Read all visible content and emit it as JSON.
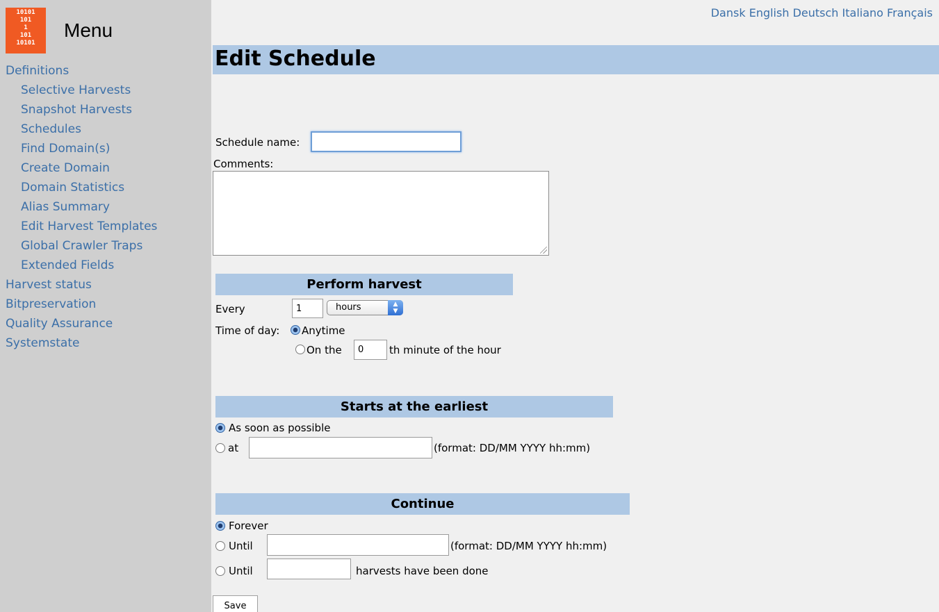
{
  "sidebar": {
    "menu_title": "Menu",
    "logo_bits": [
      "10101",
      "101",
      "1",
      "101",
      "10101"
    ],
    "items": [
      {
        "label": "Definitions",
        "level": "top"
      },
      {
        "label": "Selective Harvests",
        "level": "sub"
      },
      {
        "label": "Snapshot Harvests",
        "level": "sub"
      },
      {
        "label": "Schedules",
        "level": "sub"
      },
      {
        "label": "Find Domain(s)",
        "level": "sub"
      },
      {
        "label": "Create Domain",
        "level": "sub"
      },
      {
        "label": "Domain Statistics",
        "level": "sub"
      },
      {
        "label": "Alias Summary",
        "level": "sub"
      },
      {
        "label": "Edit Harvest Templates",
        "level": "sub"
      },
      {
        "label": "Global Crawler Traps",
        "level": "sub"
      },
      {
        "label": "Extended Fields",
        "level": "sub"
      },
      {
        "label": "Harvest status",
        "level": "top"
      },
      {
        "label": "Bitpreservation",
        "level": "top"
      },
      {
        "label": "Quality Assurance",
        "level": "top"
      },
      {
        "label": "Systemstate",
        "level": "top"
      }
    ]
  },
  "languages": [
    "Dansk",
    "English",
    "Deutsch",
    "Italiano",
    "Français"
  ],
  "page_title": "Edit Schedule",
  "form": {
    "schedule_name_label": "Schedule name:",
    "schedule_name_value": "",
    "comments_label": "Comments:",
    "comments_value": ""
  },
  "perform_harvest": {
    "header": "Perform harvest",
    "every_label": "Every",
    "every_value": "1",
    "unit_selected": "hours",
    "time_of_day_label": "Time of day:",
    "anytime_label": "Anytime",
    "on_the_label": "On the",
    "minute_value": "0",
    "minute_suffix": "th minute of the hour",
    "selected": "anytime"
  },
  "starts": {
    "header": "Starts at the earliest",
    "asap_label": "As soon as possible",
    "at_label": "at",
    "at_value": "",
    "format_hint": "(format: DD/MM YYYY hh:mm)",
    "selected": "asap"
  },
  "continue": {
    "header": "Continue",
    "forever_label": "Forever",
    "until_label": "Until",
    "until_value": "",
    "format_hint": "(format: DD/MM YYYY hh:mm)",
    "until_harvests_label": "Until",
    "harvests_value": "",
    "harvests_suffix": "harvests have been done",
    "selected": "forever"
  },
  "save_label": "Save"
}
